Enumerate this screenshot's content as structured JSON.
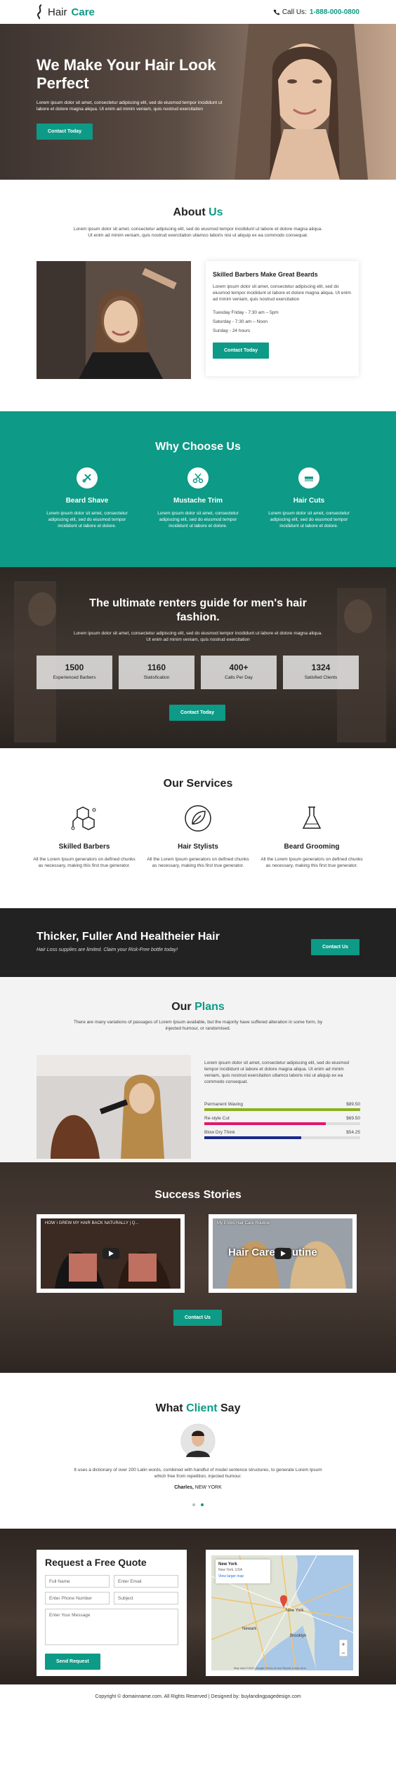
{
  "header": {
    "logo_text_1": "Hair",
    "logo_text_2": "Care",
    "call_label": "Call Us:",
    "phone": "1-888-000-0800"
  },
  "hero": {
    "title": "We Make Your Hair Look Perfect",
    "text": "Lorem ipsum dolor sit amet, consectetur adipiscing elit, sed do eiusmod tempor incididunt ut labore et dolore magna aliqua. Ut enim ad minim veniam, quis nostrud exercitation",
    "cta": "Contact Today"
  },
  "about": {
    "title_1": "About",
    "title_2": "Us",
    "text": "Lorem ipsum dolor sit amet, consectetur adipiscing elit, sed do eiusmod tempor incididunt ut labore et dolore magna aliqua. Ut enim ad minim veniam, quis nostrud exercitation ullamco laboris nisi ut aliquip ex ea commodo consequat.",
    "card_title": "Skilled Barbers Make Great Beards",
    "card_text": "Lorem ipsum dolor sit amet, consectetur adipiscing elit, sed do eiusmod tempor incididunt ut labore et dolore magna aliqua. Ut enim ad minim veniam, quis nostrud exercitation",
    "hours": [
      "Tuesday Friday - 7:30 am – 5pm",
      "Saturday - 7:30 am – Noon",
      "Sunday - 24 hours"
    ],
    "cta": "Contact Today"
  },
  "why": {
    "title": "Why Choose Us",
    "items": [
      {
        "title": "Beard Shave",
        "text": "Lorem ipsum dolor sit amet, consectetur adipiscing elit, sed do eiusmod tempor incididunt ut labore et dolore."
      },
      {
        "title": "Mustache Trim",
        "text": "Lorem ipsum dolor sit amet, consectetur adipiscing elit, sed do eiusmod tempor incididunt ut labore et dolore."
      },
      {
        "title": "Hair Cuts",
        "text": "Lorem ipsum dolor sit amet, consectetur adipiscing elit, sed do eiusmod tempor incididunt ut labore et dolore."
      }
    ]
  },
  "renters": {
    "title": "The ultimate renters guide for men's hair fashion.",
    "text": "Lorem ipsum dolor sit amet, consectetur adipiscing elit, sed do eiusmod tempor incididunt ut labore et dolore magna aliqua. Ut enim ad minim veniam, quis nostrud exercitation",
    "stats": [
      {
        "num": "1500",
        "label": "Experienced Barbers"
      },
      {
        "num": "1160",
        "label": "Statisfication"
      },
      {
        "num": "400+",
        "label": "Calls Per Day"
      },
      {
        "num": "1324",
        "label": "Satisfied Clients"
      }
    ],
    "cta": "Contact Today"
  },
  "services": {
    "title": "Our Services",
    "items": [
      {
        "title": "Skilled Barbers",
        "text": "All the Lorem Ipsum generators on defined chunks as necessary, making this first true generator."
      },
      {
        "title": "Hair Stylists",
        "text": "All the Lorem Ipsum generators on defined chunks as necessary, making this first true generator."
      },
      {
        "title": "Beard Grooming",
        "text": "All the Lorem Ipsum generators on defined chunks as necessary, making this first true generator."
      }
    ]
  },
  "thicker": {
    "title": "Thicker, Fuller And Healtheier Hair",
    "sub": "Hair Loss supplies are limited. Claim your Risk-Free bottle today!",
    "cta": "Contact Us"
  },
  "plans": {
    "title_1": "Our",
    "title_2": "Plans",
    "sub": "There are many variations of passages of Lorem Ipsum available, but the majority have suffered alteration in some form, by injected humour, or randomised.",
    "text": "Lorem ipsum dolor sit amet, consectetur adipiscing elit, sed do eiusmod tempor incididunt ut labore et dolore magna aliqua. Ut enim ad minim veniam, quis nostrud exercitation ullamco laboris nisi ut aliquip ex ea commodo consequat.",
    "bars": [
      {
        "label": "Permanent Waving",
        "price": "$89.50",
        "fill": 1.0,
        "color": "#8db020"
      },
      {
        "label": "Re-style Cut",
        "price": "$69.50",
        "fill": 0.78,
        "color": "#e2176a"
      },
      {
        "label": "Blow Dry Think",
        "price": "$54.25",
        "fill": 0.62,
        "color": "#1a2a8a"
      }
    ]
  },
  "success": {
    "title": "Success Stories",
    "videos": [
      {
        "title": "HOW I GREW MY HAIR BACK NATURALLY | Q..."
      },
      {
        "title": "My Entire Hair Care Routine",
        "overlay": "Hair Care Routine"
      }
    ],
    "cta": "Contact Us"
  },
  "testimonial": {
    "title_1": "What",
    "title_2": "Client",
    "title_3": "Say",
    "text": "It uses a dictionary of over 200 Latin words, combined with handful of model sentence structures, to generate Lorem Ipsum which free from repetition, injected humour.",
    "name": "Charles,",
    "location": "NEW YORK"
  },
  "quote": {
    "title": "Request a Free Quote",
    "placeholders": {
      "name": "Full Name",
      "email": "Enter Email",
      "phone": "Enter Phone Number",
      "subject": "Subject",
      "message": "Enter Your Message"
    },
    "cta": "Send Request",
    "map": {
      "place": "New York",
      "sub": "New York, USA",
      "link": "View larger map",
      "labels": [
        "Newark",
        "New York",
        "Brooklyn"
      ],
      "credit": "Map data ©2022 Google  Terms of Use  Report a map error"
    }
  },
  "footer": {
    "text": "Copyright © domainname.com. All Rights Reserved | Designed by: buylandingpagedesign.com"
  },
  "colors": {
    "accent": "#0d9a86",
    "dark": "#222222"
  }
}
